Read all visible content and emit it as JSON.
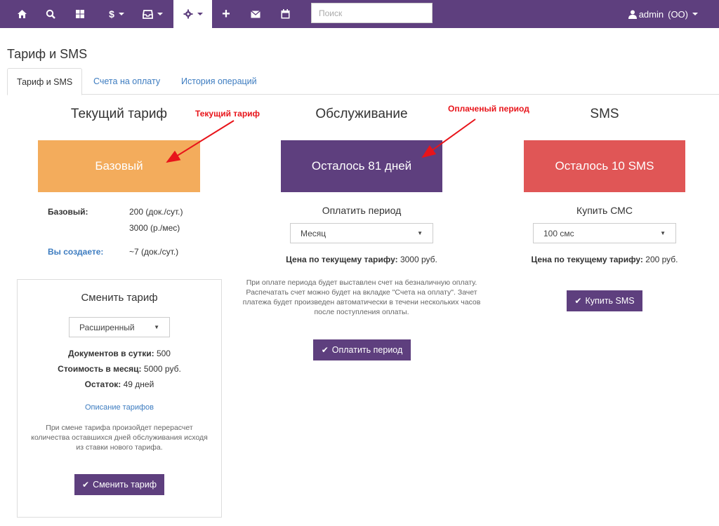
{
  "nav": {
    "icons": [
      "home-icon",
      "search-icon",
      "grid-icon",
      "dollar-icon",
      "inbox-icon",
      "gear-icon",
      "plus-icon",
      "envelope-icon",
      "calendar-icon"
    ],
    "search_placeholder": "Поиск",
    "user_name": "admin",
    "user_org": "(ОО)"
  },
  "page": {
    "title": "Тариф и SMS"
  },
  "tabs": [
    "Тариф и SMS",
    "Счета на оплату",
    "История операций"
  ],
  "tariff": {
    "title": "Текущий тариф",
    "annotation": "Текущий тариф",
    "tile": "Базовый",
    "color": "#f3ac5c",
    "name_label": "Базовый:",
    "docs": "200 (док./сут.)",
    "price": "3000 (р./мес)",
    "you_create_label": "Вы создаете:",
    "you_create_value": "~7 (док./сут.)"
  },
  "change": {
    "title": "Сменить тариф",
    "selected": "Расширенный",
    "docs_label": "Документов в сутки:",
    "docs_value": "500",
    "cost_label": "Стоимость в месяц:",
    "cost_value": "5000 руб.",
    "rest_label": "Остаток:",
    "rest_value": "49 дней",
    "link": "Описание тарифов",
    "note": "При смене тарифа произойдет перерасчет количества оставшихся дней обслуживания исходя из ставки нового тарифа.",
    "button": "Сменить тариф"
  },
  "service": {
    "title": "Обслуживание",
    "annotation": "Оплаченый период",
    "tile": "Осталось 81 дней",
    "color": "#5e3f7e",
    "subtitle": "Оплатить период",
    "selected": "Месяц",
    "price_label": "Цена по текущему тарифу:",
    "price_value": "3000 руб.",
    "note": "При оплате периода будет выставлен счет на безналичную оплату. Распечатать счет можно будет на вкладке \"Счета на оплату\". Зачет платежа будет произведен автоматически в течени нескольких часов после поступления оплаты.",
    "button": "Оплатить период"
  },
  "sms": {
    "title": "SMS",
    "tile": "Осталось 10 SMS",
    "color": "#e05656",
    "subtitle": "Купить СМС",
    "selected": "100 смс",
    "price_label": "Цена по текущему тарифу:",
    "price_value": "200 руб.",
    "button": "Купить SMS"
  }
}
